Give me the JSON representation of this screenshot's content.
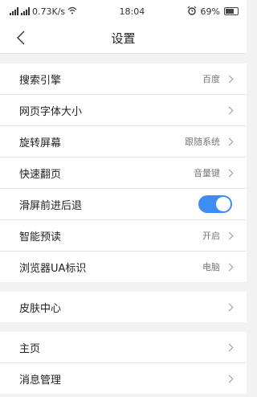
{
  "status": {
    "network_speed": "0.73K/s",
    "time": "18:04",
    "battery": "69%"
  },
  "header": {
    "title": "设置"
  },
  "groups": [
    {
      "items": [
        {
          "label": "搜索引擎",
          "value": "百度"
        },
        {
          "label": "网页字体大小",
          "value": ""
        },
        {
          "label": "旋转屏幕",
          "value": "跟随系统"
        },
        {
          "label": "快速翻页",
          "value": "音量键"
        },
        {
          "label": "滑屏前进后退",
          "toggle": true
        },
        {
          "label": "智能预读",
          "value": "开启"
        },
        {
          "label": "浏览器UA标识",
          "value": "电脑"
        }
      ]
    },
    {
      "items": [
        {
          "label": "皮肤中心",
          "value": ""
        }
      ]
    },
    {
      "items": [
        {
          "label": "主页",
          "value": ""
        },
        {
          "label": "消息管理",
          "value": ""
        }
      ]
    }
  ]
}
